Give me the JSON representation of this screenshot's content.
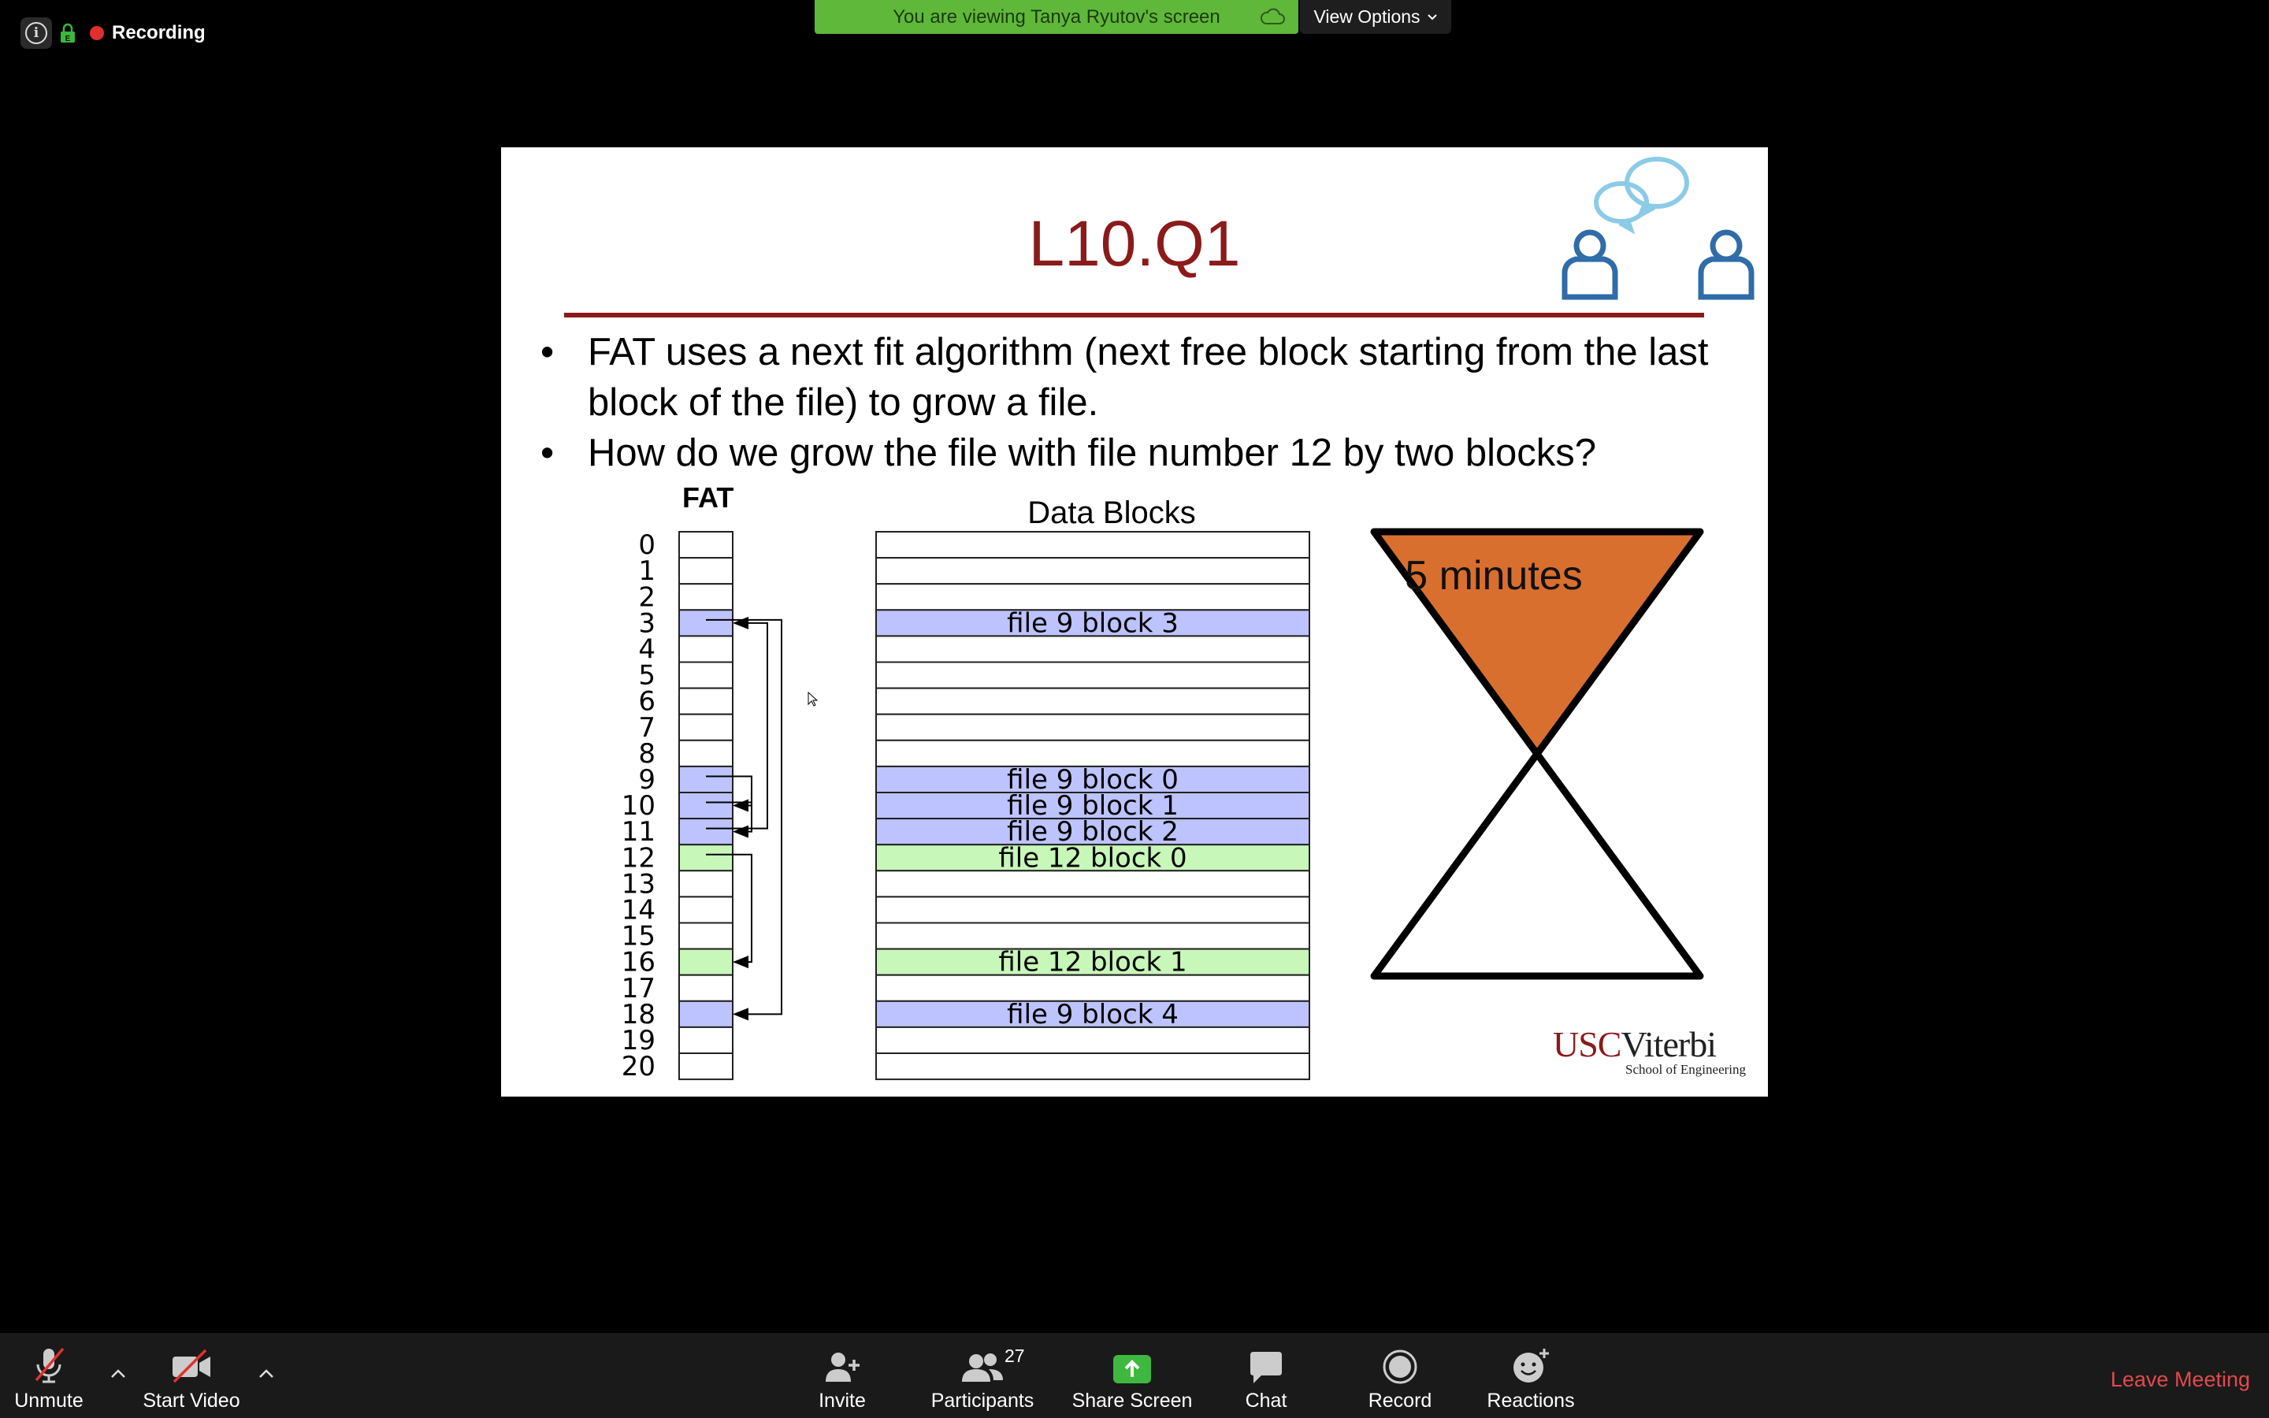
{
  "status": {
    "recording_label": "Recording"
  },
  "share_banner": {
    "text": "You are viewing Tanya Ryutov's screen",
    "view_options_label": "View Options"
  },
  "slide": {
    "title": "L10.Q1",
    "bullets": [
      "FAT uses a next fit algorithm (next free block starting from the last block of the file) to grow a file.",
      "How do we grow the file with file number 12 by two blocks?"
    ],
    "fat_label": "FAT",
    "data_blocks_label": "Data Blocks",
    "row_numbers": [
      "0",
      "1",
      "2",
      "3",
      "4",
      "5",
      "6",
      "7",
      "8",
      "9",
      "10",
      "11",
      "12",
      "13",
      "14",
      "15",
      "16",
      "17",
      "18",
      "19",
      "20"
    ],
    "fat_highlights": [
      {
        "row": 3,
        "color": "#bcc3ff"
      },
      {
        "row": 9,
        "color": "#bcc3ff"
      },
      {
        "row": 10,
        "color": "#bcc3ff"
      },
      {
        "row": 11,
        "color": "#bcc3ff"
      },
      {
        "row": 12,
        "color": "#c7f7b9"
      },
      {
        "row": 16,
        "color": "#c7f7b9"
      },
      {
        "row": 18,
        "color": "#bcc3ff"
      }
    ],
    "data_block_labels": [
      {
        "row": 3,
        "text": "file 9 block 3",
        "color": "#bcc3ff"
      },
      {
        "row": 9,
        "text": "file 9 block 0",
        "color": "#bcc3ff"
      },
      {
        "row": 10,
        "text": "file 9 block 1",
        "color": "#bcc3ff"
      },
      {
        "row": 11,
        "text": "file 9 block 2",
        "color": "#bcc3ff"
      },
      {
        "row": 12,
        "text": "file 12 block 0",
        "color": "#c7f7b9"
      },
      {
        "row": 16,
        "text": "file 12 block 1",
        "color": "#c7f7b9"
      },
      {
        "row": 18,
        "text": "file 9 block 4",
        "color": "#bcc3ff"
      }
    ],
    "timer_label": "5 minutes",
    "timer_color": "#d96f2e",
    "logo": {
      "usc": "USC",
      "viterbi": "Viterbi",
      "sub": "School of Engineering"
    }
  },
  "toolbar": {
    "unmute": "Unmute",
    "start_video": "Start Video",
    "invite": "Invite",
    "participants": "Participants",
    "participants_count": "27",
    "share_screen": "Share Screen",
    "chat": "Chat",
    "record": "Record",
    "reactions": "Reactions",
    "leave": "Leave Meeting"
  }
}
